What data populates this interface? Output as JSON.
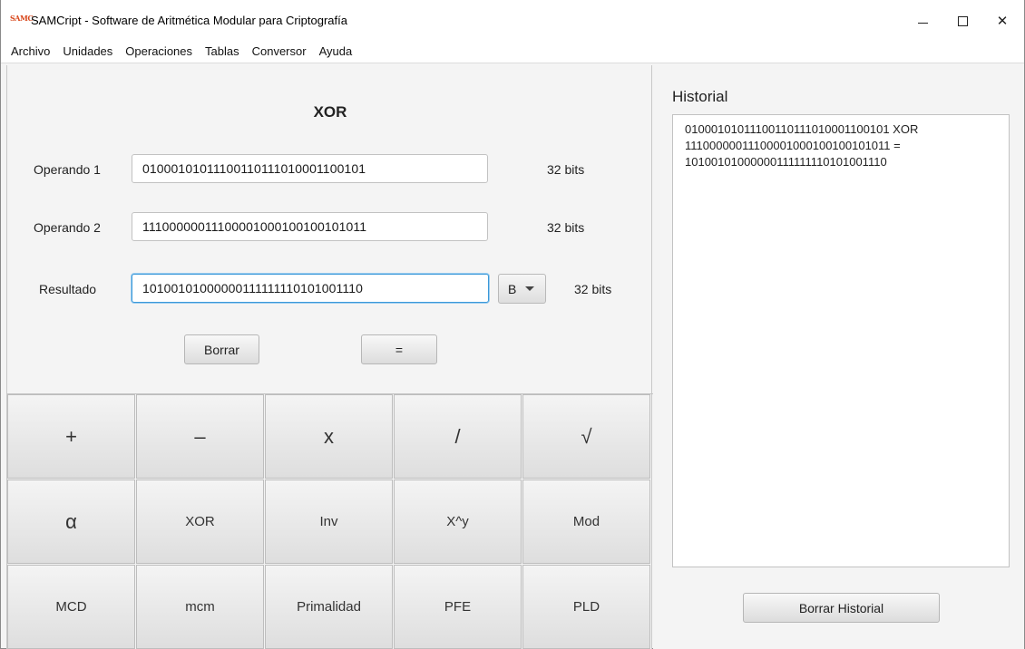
{
  "window": {
    "icon_text": "SAMCript",
    "title": "SAMCript - Software de Aritmética Modular para Criptografía",
    "controls": {
      "minimize": "minimize",
      "maximize": "maximize",
      "close": "✕"
    }
  },
  "menu": [
    "Archivo",
    "Unidades",
    "Operaciones",
    "Tablas",
    "Conversor",
    "Ayuda"
  ],
  "calculator": {
    "operation": "XOR",
    "operand1": {
      "label": "Operando 1",
      "value": "01000101011100110111010001100101",
      "bits": "32 bits"
    },
    "operand2": {
      "label": "Operando 2",
      "value": "11100000011100001000100100101011",
      "bits": "32 bits"
    },
    "result": {
      "label": "Resultado",
      "value": "10100101000000111111110101001110",
      "bits": "32 bits",
      "base": "B"
    },
    "clear_label": "Borrar",
    "equals_label": "="
  },
  "keypad": [
    "+",
    "–",
    "x",
    "/",
    "√",
    "α",
    "XOR",
    "Inv",
    "X^y",
    "Mod",
    "MCD",
    "mcm",
    "Primalidad",
    "PFE",
    "PLD"
  ],
  "history": {
    "title": "Historial",
    "lines": [
      "01000101011100110111010001100101 XOR",
      "11100000011100001000100100101011 =",
      "10100101000000111111110101001110"
    ],
    "clear_label": "Borrar Historial"
  }
}
